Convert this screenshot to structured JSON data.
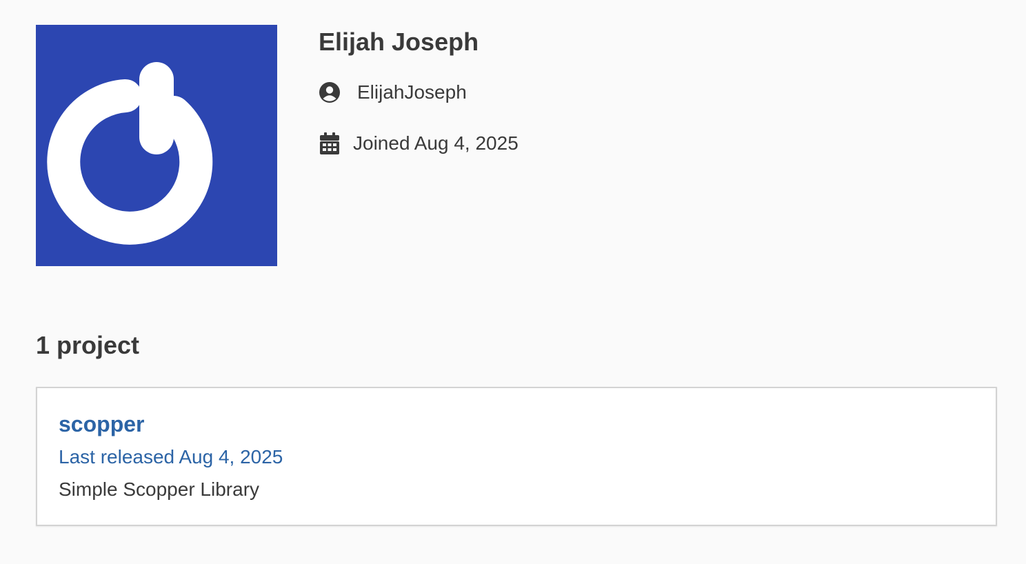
{
  "profile": {
    "display_name": "Elijah Joseph",
    "username": "ElijahJoseph",
    "joined": "Joined Aug 4, 2025",
    "avatar_icon": "power-logo",
    "avatar_bg_color": "#2c46b1"
  },
  "projects": {
    "heading": "1 project",
    "items": [
      {
        "name": "scopper",
        "released": "Last released Aug 4, 2025",
        "description": "Simple Scopper Library"
      }
    ]
  },
  "colors": {
    "link": "#2c64a6",
    "text": "#3a3a3a",
    "background": "#fafafa",
    "card_border": "#d3d3d3"
  },
  "icons": {
    "username_icon": "user-circle-icon",
    "joined_icon": "calendar-icon"
  }
}
